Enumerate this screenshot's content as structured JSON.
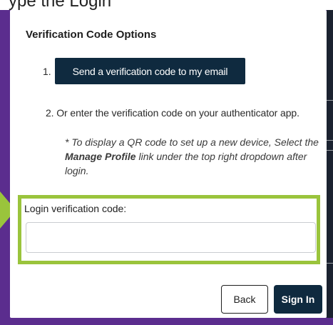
{
  "background": {
    "caption": "ype the Login"
  },
  "modal": {
    "title": "Verification Code Options",
    "step1_number": "1.",
    "send_code_label": "Send a verification code to my email",
    "step2_text": "2. Or enter the verification code on your authenticator app.",
    "qr_note": {
      "prefix": "* To display a QR code to set up a new device, Select the ",
      "link_text": "Manage Profile",
      "suffix": " link under the top right dropdown after login."
    },
    "code_field": {
      "label": "Login verification code:",
      "value": "",
      "placeholder": ""
    },
    "back_label": "Back",
    "sign_in_label": "Sign In"
  },
  "colors": {
    "frame": "#5b2d8e",
    "highlight": "#9ac43c",
    "primary_button": "#0f2a3f"
  }
}
